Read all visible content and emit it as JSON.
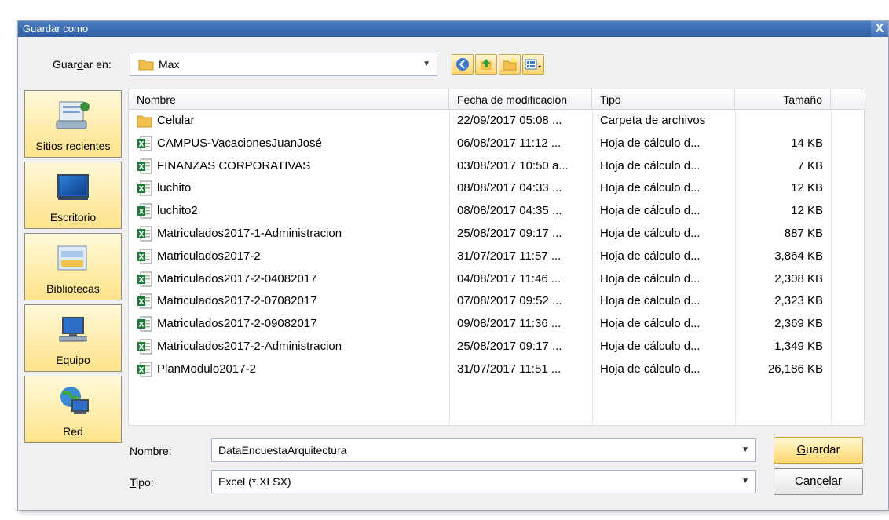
{
  "title": "Guardar como",
  "close_label": "X",
  "save_in": {
    "label_prefix": "Guar",
    "label_underlined": "d",
    "label_suffix": "ar en:",
    "folder": "Max"
  },
  "places": [
    {
      "label": "Sitios recientes",
      "icon": "recent-places-icon"
    },
    {
      "label": "Escritorio",
      "icon": "desktop-icon"
    },
    {
      "label": "Bibliotecas",
      "icon": "libraries-icon"
    },
    {
      "label": "Equipo",
      "icon": "computer-icon"
    },
    {
      "label": "Red",
      "icon": "network-icon"
    }
  ],
  "columns": {
    "name": "Nombre",
    "date": "Fecha de modificación",
    "type": "Tipo",
    "size": "Tamaño"
  },
  "files": [
    {
      "name": "Celular",
      "date": "22/09/2017 05:08 ...",
      "type": "Carpeta de archivos",
      "size": "",
      "icon": "folder-icon"
    },
    {
      "name": "CAMPUS-VacacionesJuanJosé",
      "date": "06/08/2017 11:12 ...",
      "type": "Hoja de cálculo d...",
      "size": "14 KB",
      "icon": "excel-file-icon"
    },
    {
      "name": "FINANZAS CORPORATIVAS",
      "date": "03/08/2017 10:50 a...",
      "type": "Hoja de cálculo d...",
      "size": "7 KB",
      "icon": "excel-file-icon"
    },
    {
      "name": "luchito",
      "date": "08/08/2017 04:33 ...",
      "type": "Hoja de cálculo d...",
      "size": "12 KB",
      "icon": "excel-file-icon"
    },
    {
      "name": "luchito2",
      "date": "08/08/2017 04:35 ...",
      "type": "Hoja de cálculo d...",
      "size": "12 KB",
      "icon": "excel-file-icon"
    },
    {
      "name": "Matriculados2017-1-Administracion",
      "date": "25/08/2017 09:17 ...",
      "type": "Hoja de cálculo d...",
      "size": "887 KB",
      "icon": "excel-file-icon"
    },
    {
      "name": "Matriculados2017-2",
      "date": "31/07/2017 11:57 ...",
      "type": "Hoja de cálculo d...",
      "size": "3,864 KB",
      "icon": "excel-file-icon"
    },
    {
      "name": "Matriculados2017-2-04082017",
      "date": "04/08/2017 11:46 ...",
      "type": "Hoja de cálculo d...",
      "size": "2,308 KB",
      "icon": "excel-file-icon"
    },
    {
      "name": "Matriculados2017-2-07082017",
      "date": "07/08/2017 09:52 ...",
      "type": "Hoja de cálculo d...",
      "size": "2,323 KB",
      "icon": "excel-file-icon"
    },
    {
      "name": "Matriculados2017-2-09082017",
      "date": "09/08/2017 11:36 ...",
      "type": "Hoja de cálculo d...",
      "size": "2,369 KB",
      "icon": "excel-file-icon"
    },
    {
      "name": "Matriculados2017-2-Administracion",
      "date": "25/08/2017 09:17 ...",
      "type": "Hoja de cálculo d...",
      "size": "1,349 KB",
      "icon": "excel-file-icon"
    },
    {
      "name": "PlanModulo2017-2",
      "date": "31/07/2017 11:51 ...",
      "type": "Hoja de cálculo d...",
      "size": "26,186 KB",
      "icon": "excel-file-icon"
    }
  ],
  "filename": {
    "label_underlined": "N",
    "label_suffix": "ombre:",
    "value": "DataEncuestaArquitectura"
  },
  "filetype": {
    "label_underlined": "T",
    "label_suffix": "ipo:",
    "value": "Excel (*.XLSX)"
  },
  "buttons": {
    "save_underlined": "G",
    "save_suffix": "uardar",
    "cancel": "Cancelar"
  }
}
